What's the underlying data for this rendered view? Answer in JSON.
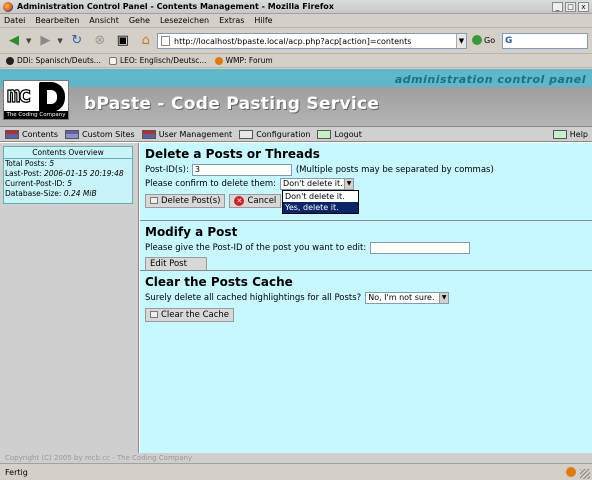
{
  "window": {
    "title": "Administration Control Panel - Contents Management - Mozilla Firefox",
    "controls": [
      "_",
      "□",
      "x"
    ]
  },
  "menu": [
    "Datei",
    "Bearbeiten",
    "Ansicht",
    "Gehe",
    "Lesezeichen",
    "Extras",
    "Hilfe"
  ],
  "toolbar": {
    "url": "http://localhost/bpaste.local/acp.php?acp[action]=contents",
    "go_label": "Go",
    "search_value": "G"
  },
  "bookmarks": [
    {
      "label": "DDi: Spanisch/Deuts...",
      "icon": "dict-icon"
    },
    {
      "label": "LEO: Englisch/Deutsc...",
      "icon": "leo-icon"
    },
    {
      "label": "WMP: Forum",
      "icon": "wmp-icon"
    }
  ],
  "page": {
    "header_title": "administration control panel",
    "logo_text": "The Coding Company",
    "site_title": "bPaste - Code Pasting Service",
    "tabs": [
      "Contents",
      "Custom Sites",
      "User Management",
      "Configuration",
      "Logout"
    ],
    "help_label": "Help",
    "overview": {
      "title": "Contents Overview",
      "rows": [
        {
          "label": "Total Posts:",
          "value": "5"
        },
        {
          "label": "Last-Post:",
          "value": "2006-01-15 20:19:48"
        },
        {
          "label": "Current-Post-ID:",
          "value": "5"
        },
        {
          "label": "Database-Size:",
          "value": "0.24 MiB"
        }
      ]
    },
    "delete_section": {
      "heading": "Delete a Posts or Threads",
      "post_ids_label": "Post-ID(s):",
      "post_ids_value": "3",
      "hint": "(Multiple posts may be separated by commas)",
      "confirm_label": "Please confirm to delete them:",
      "confirm_selected": "Don't delete it.",
      "confirm_options": [
        "Don't delete it.",
        "Yes, delete it."
      ],
      "delete_button": "Delete Post(s)",
      "cancel_button": "Cancel"
    },
    "modify_section": {
      "heading": "Modify a Post",
      "prompt": "Please give the Post-ID of the post you want to edit:",
      "post_id_value": "",
      "edit_button": "Edit Post"
    },
    "cache_section": {
      "heading": "Clear the Posts Cache",
      "prompt": "Surely delete all cached highlightings for all Posts?",
      "selected": "No, I'm not sure.",
      "clear_button": "Clear the Cache"
    },
    "footer": "Copyright (C) 2005 by mcb.cc - The Coding Company"
  },
  "status": "Fertig"
}
